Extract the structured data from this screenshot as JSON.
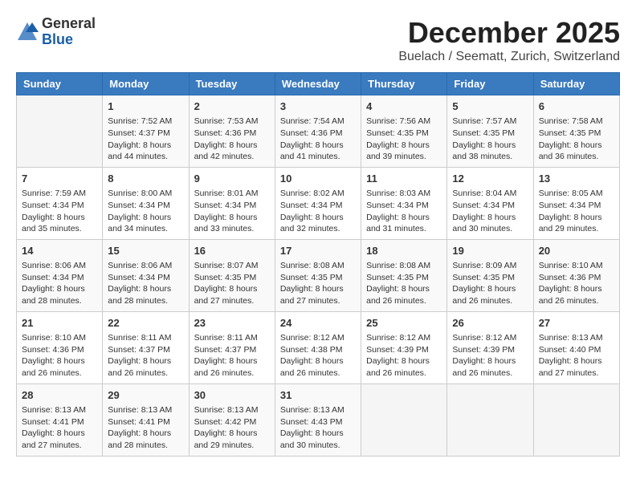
{
  "header": {
    "logo_general": "General",
    "logo_blue": "Blue",
    "month_title": "December 2025",
    "location": "Buelach / Seematt, Zurich, Switzerland"
  },
  "calendar": {
    "days_of_week": [
      "Sunday",
      "Monday",
      "Tuesday",
      "Wednesday",
      "Thursday",
      "Friday",
      "Saturday"
    ],
    "weeks": [
      [
        {
          "day": "",
          "empty": true
        },
        {
          "day": "1",
          "sunrise": "Sunrise: 7:52 AM",
          "sunset": "Sunset: 4:37 PM",
          "daylight": "Daylight: 8 hours and 44 minutes."
        },
        {
          "day": "2",
          "sunrise": "Sunrise: 7:53 AM",
          "sunset": "Sunset: 4:36 PM",
          "daylight": "Daylight: 8 hours and 42 minutes."
        },
        {
          "day": "3",
          "sunrise": "Sunrise: 7:54 AM",
          "sunset": "Sunset: 4:36 PM",
          "daylight": "Daylight: 8 hours and 41 minutes."
        },
        {
          "day": "4",
          "sunrise": "Sunrise: 7:56 AM",
          "sunset": "Sunset: 4:35 PM",
          "daylight": "Daylight: 8 hours and 39 minutes."
        },
        {
          "day": "5",
          "sunrise": "Sunrise: 7:57 AM",
          "sunset": "Sunset: 4:35 PM",
          "daylight": "Daylight: 8 hours and 38 minutes."
        },
        {
          "day": "6",
          "sunrise": "Sunrise: 7:58 AM",
          "sunset": "Sunset: 4:35 PM",
          "daylight": "Daylight: 8 hours and 36 minutes."
        }
      ],
      [
        {
          "day": "7",
          "sunrise": "Sunrise: 7:59 AM",
          "sunset": "Sunset: 4:34 PM",
          "daylight": "Daylight: 8 hours and 35 minutes."
        },
        {
          "day": "8",
          "sunrise": "Sunrise: 8:00 AM",
          "sunset": "Sunset: 4:34 PM",
          "daylight": "Daylight: 8 hours and 34 minutes."
        },
        {
          "day": "9",
          "sunrise": "Sunrise: 8:01 AM",
          "sunset": "Sunset: 4:34 PM",
          "daylight": "Daylight: 8 hours and 33 minutes."
        },
        {
          "day": "10",
          "sunrise": "Sunrise: 8:02 AM",
          "sunset": "Sunset: 4:34 PM",
          "daylight": "Daylight: 8 hours and 32 minutes."
        },
        {
          "day": "11",
          "sunrise": "Sunrise: 8:03 AM",
          "sunset": "Sunset: 4:34 PM",
          "daylight": "Daylight: 8 hours and 31 minutes."
        },
        {
          "day": "12",
          "sunrise": "Sunrise: 8:04 AM",
          "sunset": "Sunset: 4:34 PM",
          "daylight": "Daylight: 8 hours and 30 minutes."
        },
        {
          "day": "13",
          "sunrise": "Sunrise: 8:05 AM",
          "sunset": "Sunset: 4:34 PM",
          "daylight": "Daylight: 8 hours and 29 minutes."
        }
      ],
      [
        {
          "day": "14",
          "sunrise": "Sunrise: 8:06 AM",
          "sunset": "Sunset: 4:34 PM",
          "daylight": "Daylight: 8 hours and 28 minutes."
        },
        {
          "day": "15",
          "sunrise": "Sunrise: 8:06 AM",
          "sunset": "Sunset: 4:34 PM",
          "daylight": "Daylight: 8 hours and 28 minutes."
        },
        {
          "day": "16",
          "sunrise": "Sunrise: 8:07 AM",
          "sunset": "Sunset: 4:35 PM",
          "daylight": "Daylight: 8 hours and 27 minutes."
        },
        {
          "day": "17",
          "sunrise": "Sunrise: 8:08 AM",
          "sunset": "Sunset: 4:35 PM",
          "daylight": "Daylight: 8 hours and 27 minutes."
        },
        {
          "day": "18",
          "sunrise": "Sunrise: 8:08 AM",
          "sunset": "Sunset: 4:35 PM",
          "daylight": "Daylight: 8 hours and 26 minutes."
        },
        {
          "day": "19",
          "sunrise": "Sunrise: 8:09 AM",
          "sunset": "Sunset: 4:35 PM",
          "daylight": "Daylight: 8 hours and 26 minutes."
        },
        {
          "day": "20",
          "sunrise": "Sunrise: 8:10 AM",
          "sunset": "Sunset: 4:36 PM",
          "daylight": "Daylight: 8 hours and 26 minutes."
        }
      ],
      [
        {
          "day": "21",
          "sunrise": "Sunrise: 8:10 AM",
          "sunset": "Sunset: 4:36 PM",
          "daylight": "Daylight: 8 hours and 26 minutes."
        },
        {
          "day": "22",
          "sunrise": "Sunrise: 8:11 AM",
          "sunset": "Sunset: 4:37 PM",
          "daylight": "Daylight: 8 hours and 26 minutes."
        },
        {
          "day": "23",
          "sunrise": "Sunrise: 8:11 AM",
          "sunset": "Sunset: 4:37 PM",
          "daylight": "Daylight: 8 hours and 26 minutes."
        },
        {
          "day": "24",
          "sunrise": "Sunrise: 8:12 AM",
          "sunset": "Sunset: 4:38 PM",
          "daylight": "Daylight: 8 hours and 26 minutes."
        },
        {
          "day": "25",
          "sunrise": "Sunrise: 8:12 AM",
          "sunset": "Sunset: 4:39 PM",
          "daylight": "Daylight: 8 hours and 26 minutes."
        },
        {
          "day": "26",
          "sunrise": "Sunrise: 8:12 AM",
          "sunset": "Sunset: 4:39 PM",
          "daylight": "Daylight: 8 hours and 26 minutes."
        },
        {
          "day": "27",
          "sunrise": "Sunrise: 8:13 AM",
          "sunset": "Sunset: 4:40 PM",
          "daylight": "Daylight: 8 hours and 27 minutes."
        }
      ],
      [
        {
          "day": "28",
          "sunrise": "Sunrise: 8:13 AM",
          "sunset": "Sunset: 4:41 PM",
          "daylight": "Daylight: 8 hours and 27 minutes."
        },
        {
          "day": "29",
          "sunrise": "Sunrise: 8:13 AM",
          "sunset": "Sunset: 4:41 PM",
          "daylight": "Daylight: 8 hours and 28 minutes."
        },
        {
          "day": "30",
          "sunrise": "Sunrise: 8:13 AM",
          "sunset": "Sunset: 4:42 PM",
          "daylight": "Daylight: 8 hours and 29 minutes."
        },
        {
          "day": "31",
          "sunrise": "Sunrise: 8:13 AM",
          "sunset": "Sunset: 4:43 PM",
          "daylight": "Daylight: 8 hours and 30 minutes."
        },
        {
          "day": "",
          "empty": true
        },
        {
          "day": "",
          "empty": true
        },
        {
          "day": "",
          "empty": true
        }
      ]
    ]
  }
}
